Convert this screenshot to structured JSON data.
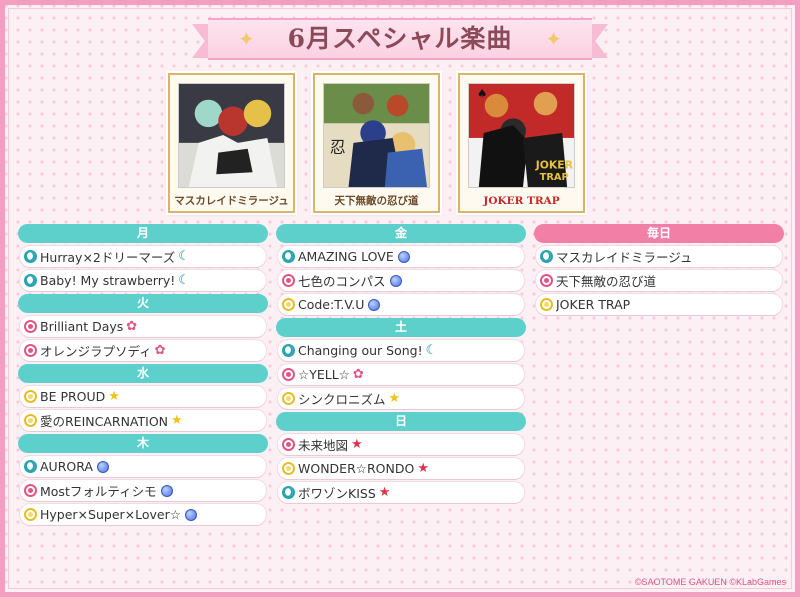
{
  "title": "6月スペシャル楽曲",
  "albums": [
    {
      "caption": "マスカレイドミラージュ"
    },
    {
      "caption": "天下無敵の忍び道"
    },
    {
      "caption": "JOKER TRAP"
    }
  ],
  "columns": [
    {
      "groups": [
        {
          "day": "月",
          "songs": [
            {
              "title": "Hurray×2ドリーマーズ",
              "icon": "moon-icon",
              "tail": "moon-icon"
            },
            {
              "title": "Baby! My strawberry!",
              "icon": "moon-icon",
              "tail": "moon-icon"
            }
          ]
        },
        {
          "day": "火",
          "songs": [
            {
              "title": "Brilliant Days",
              "icon": "flower-icon",
              "tail": "flower-icon"
            },
            {
              "title": "オレンジラプソディ",
              "icon": "flower-icon",
              "tail": "flower-icon"
            }
          ]
        },
        {
          "day": "水",
          "songs": [
            {
              "title": "BE PROUD",
              "icon": "sun-icon",
              "tail": "star-icon"
            },
            {
              "title": "愛のREINCARNATION",
              "icon": "sun-icon",
              "tail": "star-icon"
            }
          ]
        },
        {
          "day": "木",
          "songs": [
            {
              "title": "AURORA",
              "icon": "moon-icon",
              "tail": "globe-icon"
            },
            {
              "title": "Mostフォルティシモ",
              "icon": "flower-icon",
              "tail": "globe-icon"
            },
            {
              "title": "Hyper×Super×Lover☆",
              "icon": "sun-icon",
              "tail": "globe-icon"
            }
          ]
        }
      ]
    },
    {
      "groups": [
        {
          "day": "金",
          "songs": [
            {
              "title": "AMAZING LOVE",
              "icon": "moon-icon",
              "tail": "globe-icon"
            },
            {
              "title": "七色のコンパス",
              "icon": "flower-icon",
              "tail": "globe-icon"
            },
            {
              "title": "Code:T.V.U",
              "icon": "sun-icon",
              "tail": "globe-icon"
            }
          ]
        },
        {
          "day": "土",
          "songs": [
            {
              "title": "Changing our Song!",
              "icon": "moon-icon",
              "tail": "moon-icon"
            },
            {
              "title": "☆YELL☆",
              "icon": "flower-icon",
              "tail": "flower-icon"
            },
            {
              "title": "シンクロニズム",
              "icon": "sun-icon",
              "tail": "star-icon"
            }
          ]
        },
        {
          "day": "日",
          "songs": [
            {
              "title": "未来地図",
              "icon": "flower-icon",
              "tail": "red-star-icon"
            },
            {
              "title": "WONDER☆RONDO",
              "icon": "sun-icon",
              "tail": "red-star-icon"
            },
            {
              "title": "ボワゾンKISS",
              "icon": "moon-icon",
              "tail": "red-star-icon"
            }
          ]
        }
      ]
    },
    {
      "groups": [
        {
          "day": "毎日",
          "songs": [
            {
              "title": "マスカレイドミラージュ",
              "icon": "moon-icon",
              "tail": ""
            },
            {
              "title": "天下無敵の忍び道",
              "icon": "flower-icon",
              "tail": ""
            },
            {
              "title": "JOKER TRAP",
              "icon": "sun-icon",
              "tail": ""
            }
          ]
        }
      ]
    }
  ],
  "copyright": "©SAOTOME GAKUEN ©KLabGames",
  "colors": {
    "teal_header": "#5ed0cc",
    "pink_header": "#f27fa6",
    "frame": "#f29fc2",
    "title_text": "#8a4a5a"
  }
}
